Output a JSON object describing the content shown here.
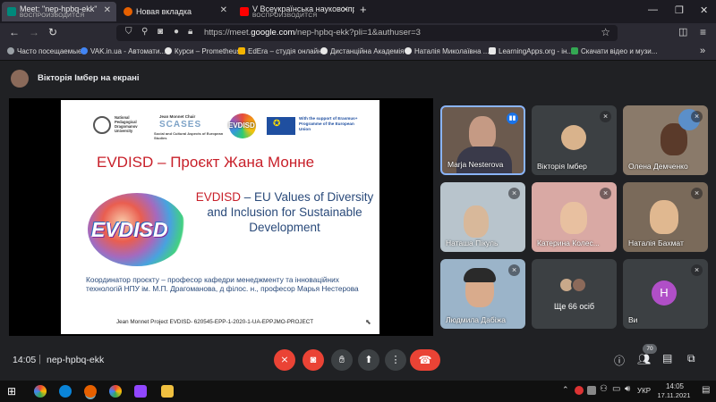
{
  "browser": {
    "tabs": [
      {
        "title": "Meet: \"nep-hpbq-ekk\"",
        "subtitle": "ВОСПРОИЗВОДИТСЯ",
        "active": true
      },
      {
        "title": "Новая вкладка",
        "subtitle": "",
        "active": false
      },
      {
        "title": "V Всеукраїнська науково-пра",
        "subtitle": "ВОСПРОИЗВОДИТСЯ",
        "active": false
      }
    ],
    "new_tab": "+",
    "url_host": "https://meet.",
    "url_domain": "google.com",
    "url_path": "/nep-hpbq-ekk?pli=1&authuser=3",
    "bookmarks": [
      {
        "label": "Часто посещаемые",
        "color": "#9aa0a6"
      },
      {
        "label": "VAK.in.ua - Автомати...",
        "color": "#4285f4"
      },
      {
        "label": "Курси – Prometheus",
        "color": "#e8e8e8"
      },
      {
        "label": "EdEra – студія онлайн...",
        "color": "#f4b400"
      },
      {
        "label": "Дистанційна Академія",
        "color": "#e8e8e8"
      },
      {
        "label": "Наталія Миколаївна ...",
        "color": "#e8e8e8"
      },
      {
        "label": "LearningApps.org - ін...",
        "color": "#e8e8e8"
      },
      {
        "label": "Скачати відео и музи...",
        "color": "#34a853"
      }
    ]
  },
  "meet": {
    "presenter_label": "Вікторія Імбер на екрані",
    "slide": {
      "org1": "National Pedagogical Dragomanov University",
      "org2": "Jean Monnet Chair",
      "org2_logo": "SCASES",
      "org2_sub": "Social and Cultural Aspects of European Studies",
      "org3_logo": "EVDISD",
      "eu_text": "With the support of Erasmus+ Programme of the European Union",
      "title": "EVDISD – Проєкт Жана Монне",
      "big_logo": "EVDISD",
      "subtitle_brand": "EVDISD",
      "subtitle_rest": " – EU Values of Diversity and Inclusion for Sustainable Development",
      "coordinator": "Координатор проєкту – професор кафедри менеджменту та інноваційних технологій НПУ ім. М.П. Драгоманова, д філос. н., професор Марья Нестерова",
      "footer": "Jean Monnet Project EVDISD- 620545-EPP-1-2020-1-UA-EPPJMO-PROJECT"
    },
    "participants": [
      {
        "name": "Marja Nesterova",
        "speaking": true,
        "muted": false
      },
      {
        "name": "Вікторія Імбер",
        "speaking": false,
        "muted": true
      },
      {
        "name": "Олена Демченко",
        "speaking": false,
        "muted": true
      },
      {
        "name": "Наташа Пікуль",
        "speaking": false,
        "muted": true
      },
      {
        "name": "Катерина Колес...",
        "speaking": false,
        "muted": true
      },
      {
        "name": "Наталія Бахмат",
        "speaking": false,
        "muted": true
      },
      {
        "name": "Людмила Дабіжа",
        "speaking": false,
        "muted": true
      },
      {
        "name": "Ще 66 осіб",
        "speaking": false,
        "muted": false
      },
      {
        "name": "Ви",
        "speaking": false,
        "muted": true,
        "initial": "Н"
      }
    ],
    "time": "14:05",
    "separator": "|",
    "meeting_code": "nep-hpbq-ekk",
    "people_count": "70"
  },
  "taskbar": {
    "lang": "УКР",
    "clock_time": "14:05",
    "clock_date": "17.11.2021"
  }
}
